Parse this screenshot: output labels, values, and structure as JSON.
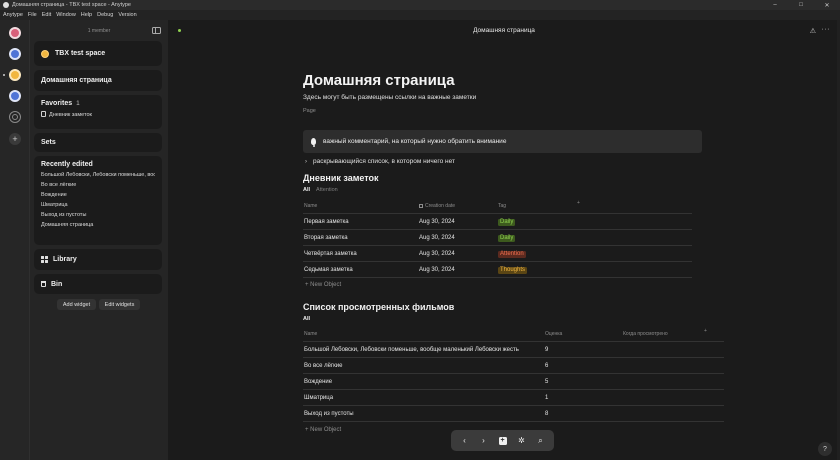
{
  "window": {
    "title": "Домашняя страница - TBX test space - Anytype",
    "controls": [
      "–",
      "□",
      "✕"
    ]
  },
  "menu": [
    "Anytype",
    "File",
    "Edit",
    "Window",
    "Help",
    "Debug",
    "Version"
  ],
  "rail": {
    "spaces": [
      "space-1",
      "space-2",
      "space-3",
      "space-4"
    ],
    "help": "⚙"
  },
  "sidebar": {
    "members": "1 member",
    "space_name": "TBX test space",
    "home": "Домашняя страница",
    "favorites": {
      "title": "Favorites",
      "count": "1",
      "items": [
        "Дневник заметок"
      ]
    },
    "sets": "Sets",
    "recent": {
      "title": "Recently edited",
      "items": [
        "Большой Лебовски, Лебовски поменьше, вообще маленький Лебовски жесть",
        "Во все лёгкие",
        "Вождение",
        "Шматрица",
        "Выход из пустоты",
        "Домашняя страница"
      ]
    },
    "library": "Library",
    "bin": "Bin",
    "add_widget": "Add widget",
    "edit_widgets": "Edit widgets"
  },
  "header": {
    "title": "Домашняя страница",
    "warn": "⚠",
    "more": "···"
  },
  "page": {
    "title": "Домашняя страница",
    "description": "Здесь могут быть размещены ссылки на важные заметки",
    "type": "Page",
    "callout": "важный комментарий, на который нужно обратить внимание",
    "toggle": "раскрывающийся список, в котором ничего нет"
  },
  "notes_set": {
    "title": "Дневник заметок",
    "views": [
      "All",
      "Attention"
    ],
    "columns": [
      "Name",
      "Creation date",
      "Tag"
    ],
    "rows": [
      {
        "name": "Первая заметка",
        "date": "Aug 30, 2024",
        "tag": "Daily"
      },
      {
        "name": "Вторая заметка",
        "date": "Aug 30, 2024",
        "tag": "Daily"
      },
      {
        "name": "Четвёртая заметка",
        "date": "Aug 30, 2024",
        "tag": "Attention"
      },
      {
        "name": "Седьмая заметка",
        "date": "Aug 30, 2024",
        "tag": "Thoughts"
      }
    ],
    "new_object": "New Object"
  },
  "films_set": {
    "title": "Список просмотренных фильмов",
    "views": [
      "All"
    ],
    "columns": [
      "Name",
      "Оценка",
      "Когда просмотрено"
    ],
    "rows": [
      {
        "name": "Большой Лебовски, Лебовски поменьше, вообще маленький Лебовски жесть",
        "score": "9"
      },
      {
        "name": "Во все лёгкие",
        "score": "6"
      },
      {
        "name": "Вождение",
        "score": "5"
      },
      {
        "name": "Шматрица",
        "score": "1"
      },
      {
        "name": "Выход из пустоты",
        "score": "8"
      }
    ],
    "new_object": "New Object"
  },
  "tag_colors": {
    "Daily": {
      "bg": "#3d5a1e",
      "fg": "#8fd14f"
    },
    "Attention": {
      "bg": "#5c2a1f",
      "fg": "#f0704f"
    },
    "Thoughts": {
      "bg": "#5a4514",
      "fg": "#f1b640"
    }
  },
  "navbar": {
    "back": "‹",
    "forward": "›",
    "plus": "+",
    "graph": "✲",
    "search": "⌕"
  },
  "help_button": "?"
}
